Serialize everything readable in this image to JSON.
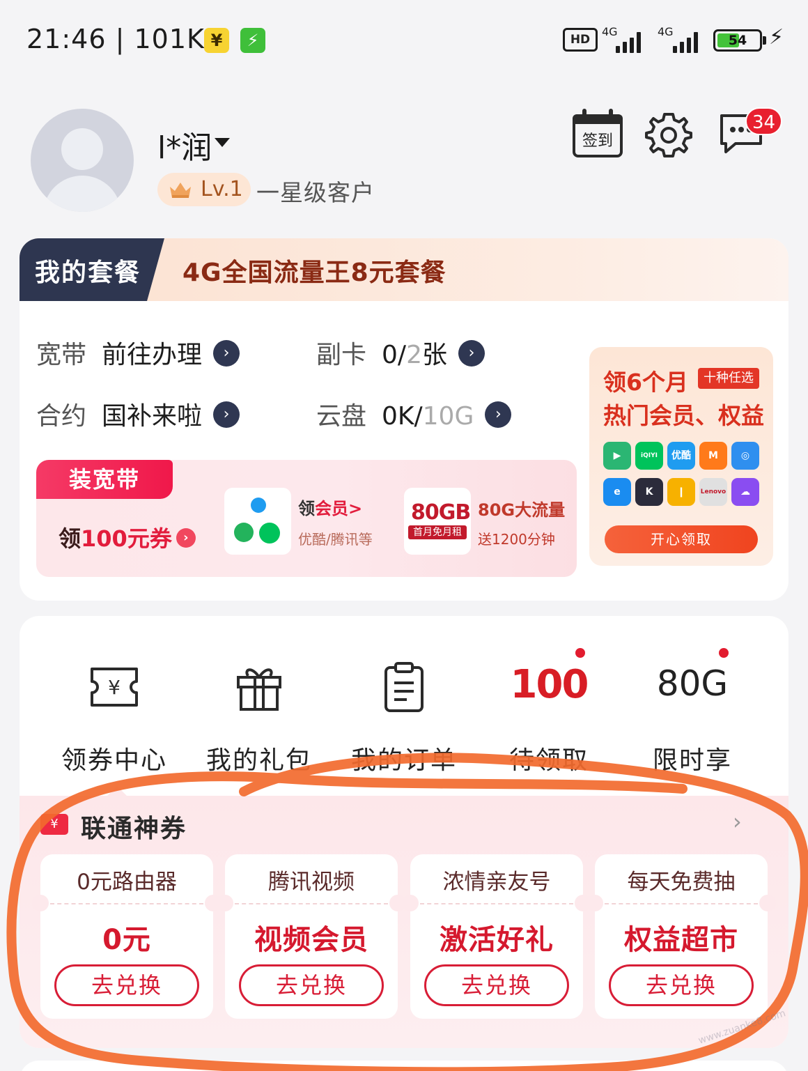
{
  "status_bar": {
    "time": "21:46 | 101K/s",
    "yuan_badge": "¥",
    "bolt_badge": "⚡",
    "hd": "HD",
    "net1": "4G",
    "net2": "4G",
    "battery": "54",
    "battery_level": 0.54,
    "charge": "⚡"
  },
  "profile": {
    "name": "l*润",
    "level": "Lv.1",
    "level_desc": "一星级客户",
    "signin_label": "签到",
    "message_count": "34",
    "icons": [
      "avatar-icon",
      "calendar-icon",
      "gear-icon",
      "chat-icon",
      "crown-icon"
    ]
  },
  "plan": {
    "tab_label": "我的套餐",
    "plan_name": "4G全国流量王8元套餐",
    "rows": {
      "broadband_label": "宽带",
      "broadband_value": "前往办理",
      "subcard_label": "副卡",
      "subcard_used": "0/",
      "subcard_total": "2",
      "subcard_unit": "张",
      "contract_label": "合约",
      "contract_value": "国补来啦",
      "cloud_label": "云盘",
      "cloud_used": "0K/",
      "cloud_total": "10G"
    },
    "arrow": "›",
    "promo": {
      "tag": "装宽带",
      "coupon_prefix": "领",
      "coupon_amount": "100元券",
      "coupon_arrow": "›",
      "member_title_prefix": "领",
      "member_title_red": "会员>",
      "member_sub": "优酷/腾讯等",
      "gb_big": "80GB",
      "gb_small": "首月免月租",
      "gb_title": "80G大流量",
      "gb_sub": "送1200分钟"
    },
    "vip": {
      "line1": "领6个月",
      "chip": "十种任选",
      "line2": "热门会员、权益",
      "button": "开心领取",
      "app_labels": [
        "▶",
        "iQIYI",
        "优酷",
        "M",
        "◎",
        "e",
        "K",
        "❙",
        "Lenovo",
        "☁"
      ],
      "app_colors": [
        "#2bb673",
        "#00c35b",
        "#1f9cf0",
        "#ff7a1a",
        "#2f8fef",
        "#1a8cf0",
        "#2b2b3b",
        "#f7b100",
        "#e0e0e0",
        "#8a4df1"
      ]
    }
  },
  "quick": {
    "items": [
      {
        "label": "领券中心",
        "icon": "ticket-yuan-icon"
      },
      {
        "label": "我的礼包",
        "icon": "gift-icon"
      },
      {
        "label": "我的订单",
        "icon": "clipboard-icon"
      },
      {
        "label": "待领取",
        "value": "100"
      },
      {
        "label": "限时享",
        "value": "80G"
      }
    ]
  },
  "coupons": {
    "title": "联通神券",
    "title_icon": "¥",
    "more": "›",
    "tiles": [
      {
        "top": "0元路由器",
        "main": "0元",
        "button": "去兑换"
      },
      {
        "top": "腾讯视频",
        "main": "视频会员",
        "button": "去兑换"
      },
      {
        "top": "浓情亲友号",
        "main": "激活好礼",
        "button": "去兑换"
      },
      {
        "top": "每天免费抽",
        "main": "权益超市",
        "button": "去兑换"
      }
    ]
  },
  "watermark": "www.zuanke8.com",
  "colors": {
    "accent_red": "#d5192e",
    "plan_tab": "#2e3650",
    "annotation": "#f26a2e"
  }
}
